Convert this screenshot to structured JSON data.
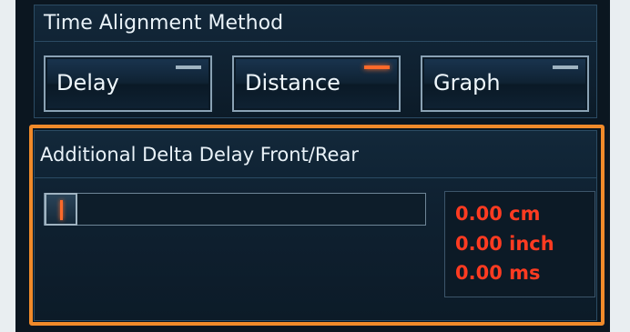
{
  "time_alignment": {
    "title": "Time Alignment Method",
    "tabs": [
      {
        "label": "Delay",
        "active": false
      },
      {
        "label": "Distance",
        "active": true
      },
      {
        "label": "Graph",
        "active": false
      }
    ]
  },
  "delta_delay": {
    "title": "Additional Delta Delay Front/Rear",
    "slider_value": 0,
    "readouts": [
      "0.00 cm",
      "0.00 inch",
      "0.00 ms"
    ]
  },
  "colors": {
    "active_indicator": "#ff6a2a",
    "inactive_indicator": "#9fb3c1",
    "readout_text": "#ff3b21",
    "highlight_border": "#f08a2a"
  }
}
